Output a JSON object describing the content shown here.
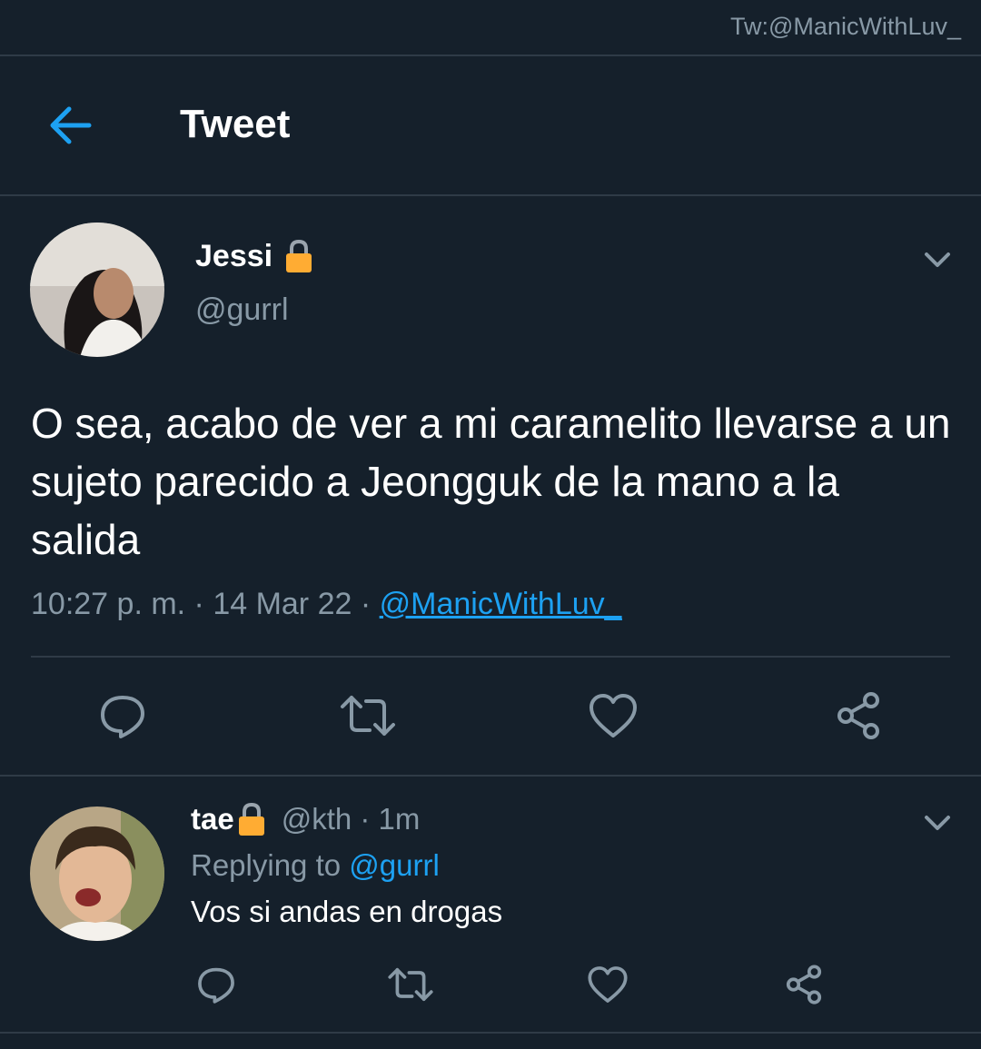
{
  "watermark": "Tw:@ManicWithLuv_",
  "header": {
    "title": "Tweet",
    "back_icon": "arrow-left-icon"
  },
  "tweet": {
    "author_name": "Jessi",
    "author_handle": "@gurrl",
    "text": "O sea, acabo de ver a mi caramelito llevarse a un sujeto parecido a Jeongguk de la mano a la salida",
    "timestamp": "10:27 p. m. · 14 Mar 22 ·",
    "source": "@ManicWithLuv_",
    "actions": [
      "reply-icon",
      "retweet-icon",
      "like-icon",
      "share-icon"
    ]
  },
  "reply": {
    "author_name": "tae",
    "author_handle": "@kth · 1m",
    "replying_prefix": "Replying to",
    "replying_handle": "@gurrl",
    "text": "Vos si andas en drogas",
    "actions": [
      "reply-icon",
      "retweet-icon",
      "like-icon",
      "share-icon"
    ]
  },
  "colors": {
    "background": "#15202b",
    "accent": "#1da1f2",
    "muted": "#8899a6",
    "divider": "#2f3b47",
    "lock": "#ffac33"
  }
}
